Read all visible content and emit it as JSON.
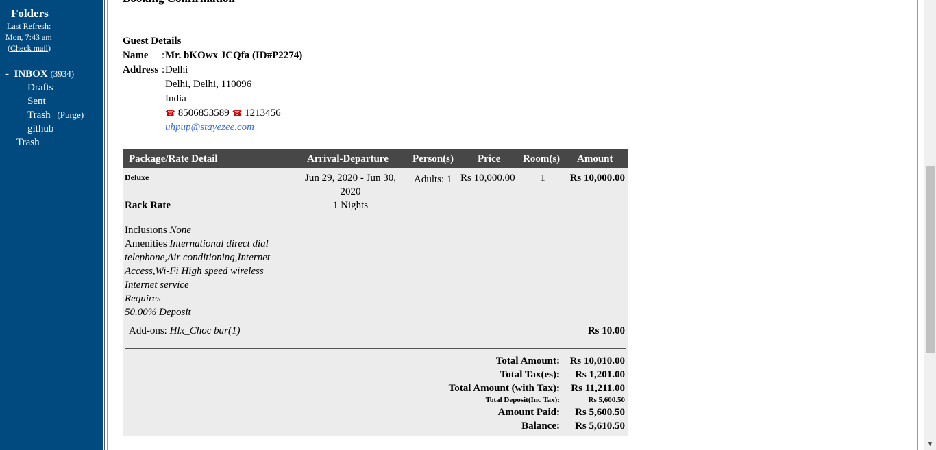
{
  "sidebar": {
    "title": "Folders",
    "last_refresh_label": "Last Refresh:",
    "last_refresh_time": "Mon, 7:43 am",
    "check_mail_open": "(",
    "check_mail": "Check mail",
    "check_mail_close": ")",
    "inbox_toggle": "-",
    "inbox": "INBOX",
    "inbox_count": "(3934)",
    "drafts": "Drafts",
    "sent": "Sent",
    "trash_sub": "Trash",
    "purge": "(Purge)",
    "github": "github",
    "trash": "Trash"
  },
  "email": {
    "heading": "Booking Confirmation",
    "guest": {
      "title": "Guest Details",
      "name_label": "Name",
      "name_value": "Mr. bKOwx JCQfa (ID#P2274)",
      "address_label": "Address",
      "colon": ":",
      "addr1": "Delhi",
      "addr2": "Delhi, Delhi, 110096",
      "addr3": "India",
      "phone1": "8506853589",
      "phone2": "1213456",
      "email": "uhpup@stayezee.com"
    },
    "table": {
      "headers": [
        "Package/Rate Detail",
        "Arrival-Departure",
        "Person(s)",
        "Price",
        "Room(s)",
        "Amount"
      ],
      "room_type": "Deluxe",
      "dates_line1": "Jun 29, 2020 - Jun 30,",
      "dates_line2": "2020",
      "nights": "1 Nights",
      "persons": "Adults: 1",
      "price": "Rs 10,000.00",
      "rooms": "1",
      "amount": "Rs 10,000.00",
      "rate_name": "Rack Rate",
      "inclusions_label": "Inclusions",
      "inclusions_value": "None",
      "amenities_label": "Amenities",
      "amenities_line1": "International direct dial",
      "amenities_line2": "telephone,Air conditioning,Internet",
      "amenities_line3": "Access,Wi-Fi High speed wireless",
      "amenities_line4": "Internet service",
      "requires_label": "Requires",
      "deposit_text": "50.00% Deposit",
      "addons_label": "Add-ons:",
      "addons_value": "Hlx_Choc bar(1)",
      "addons_amount": "Rs 10.00"
    },
    "totals": {
      "total_amount_label": "Total Amount:",
      "total_amount": "Rs 10,010.00",
      "total_tax_label": "Total Tax(es):",
      "total_tax": "Rs 1,201.00",
      "total_with_tax_label": "Total Amount (with Tax):",
      "total_with_tax": "Rs 11,211.00",
      "total_deposit_label": "Total Deposit(Inc Tax):",
      "total_deposit": "Rs 5,600.50",
      "amount_paid_label": "Amount Paid:",
      "amount_paid": "Rs 5,600.50",
      "balance_label": "Balance:",
      "balance": "Rs 5,610.50"
    }
  },
  "icons": {
    "phone": "phone-icon",
    "scroll_down": "chevron-down-icon"
  },
  "colors": {
    "sidebar_bg": "#004a80",
    "table_header_bg": "#474747",
    "table_bg": "#ececec",
    "email_link": "#3b6fd4"
  }
}
